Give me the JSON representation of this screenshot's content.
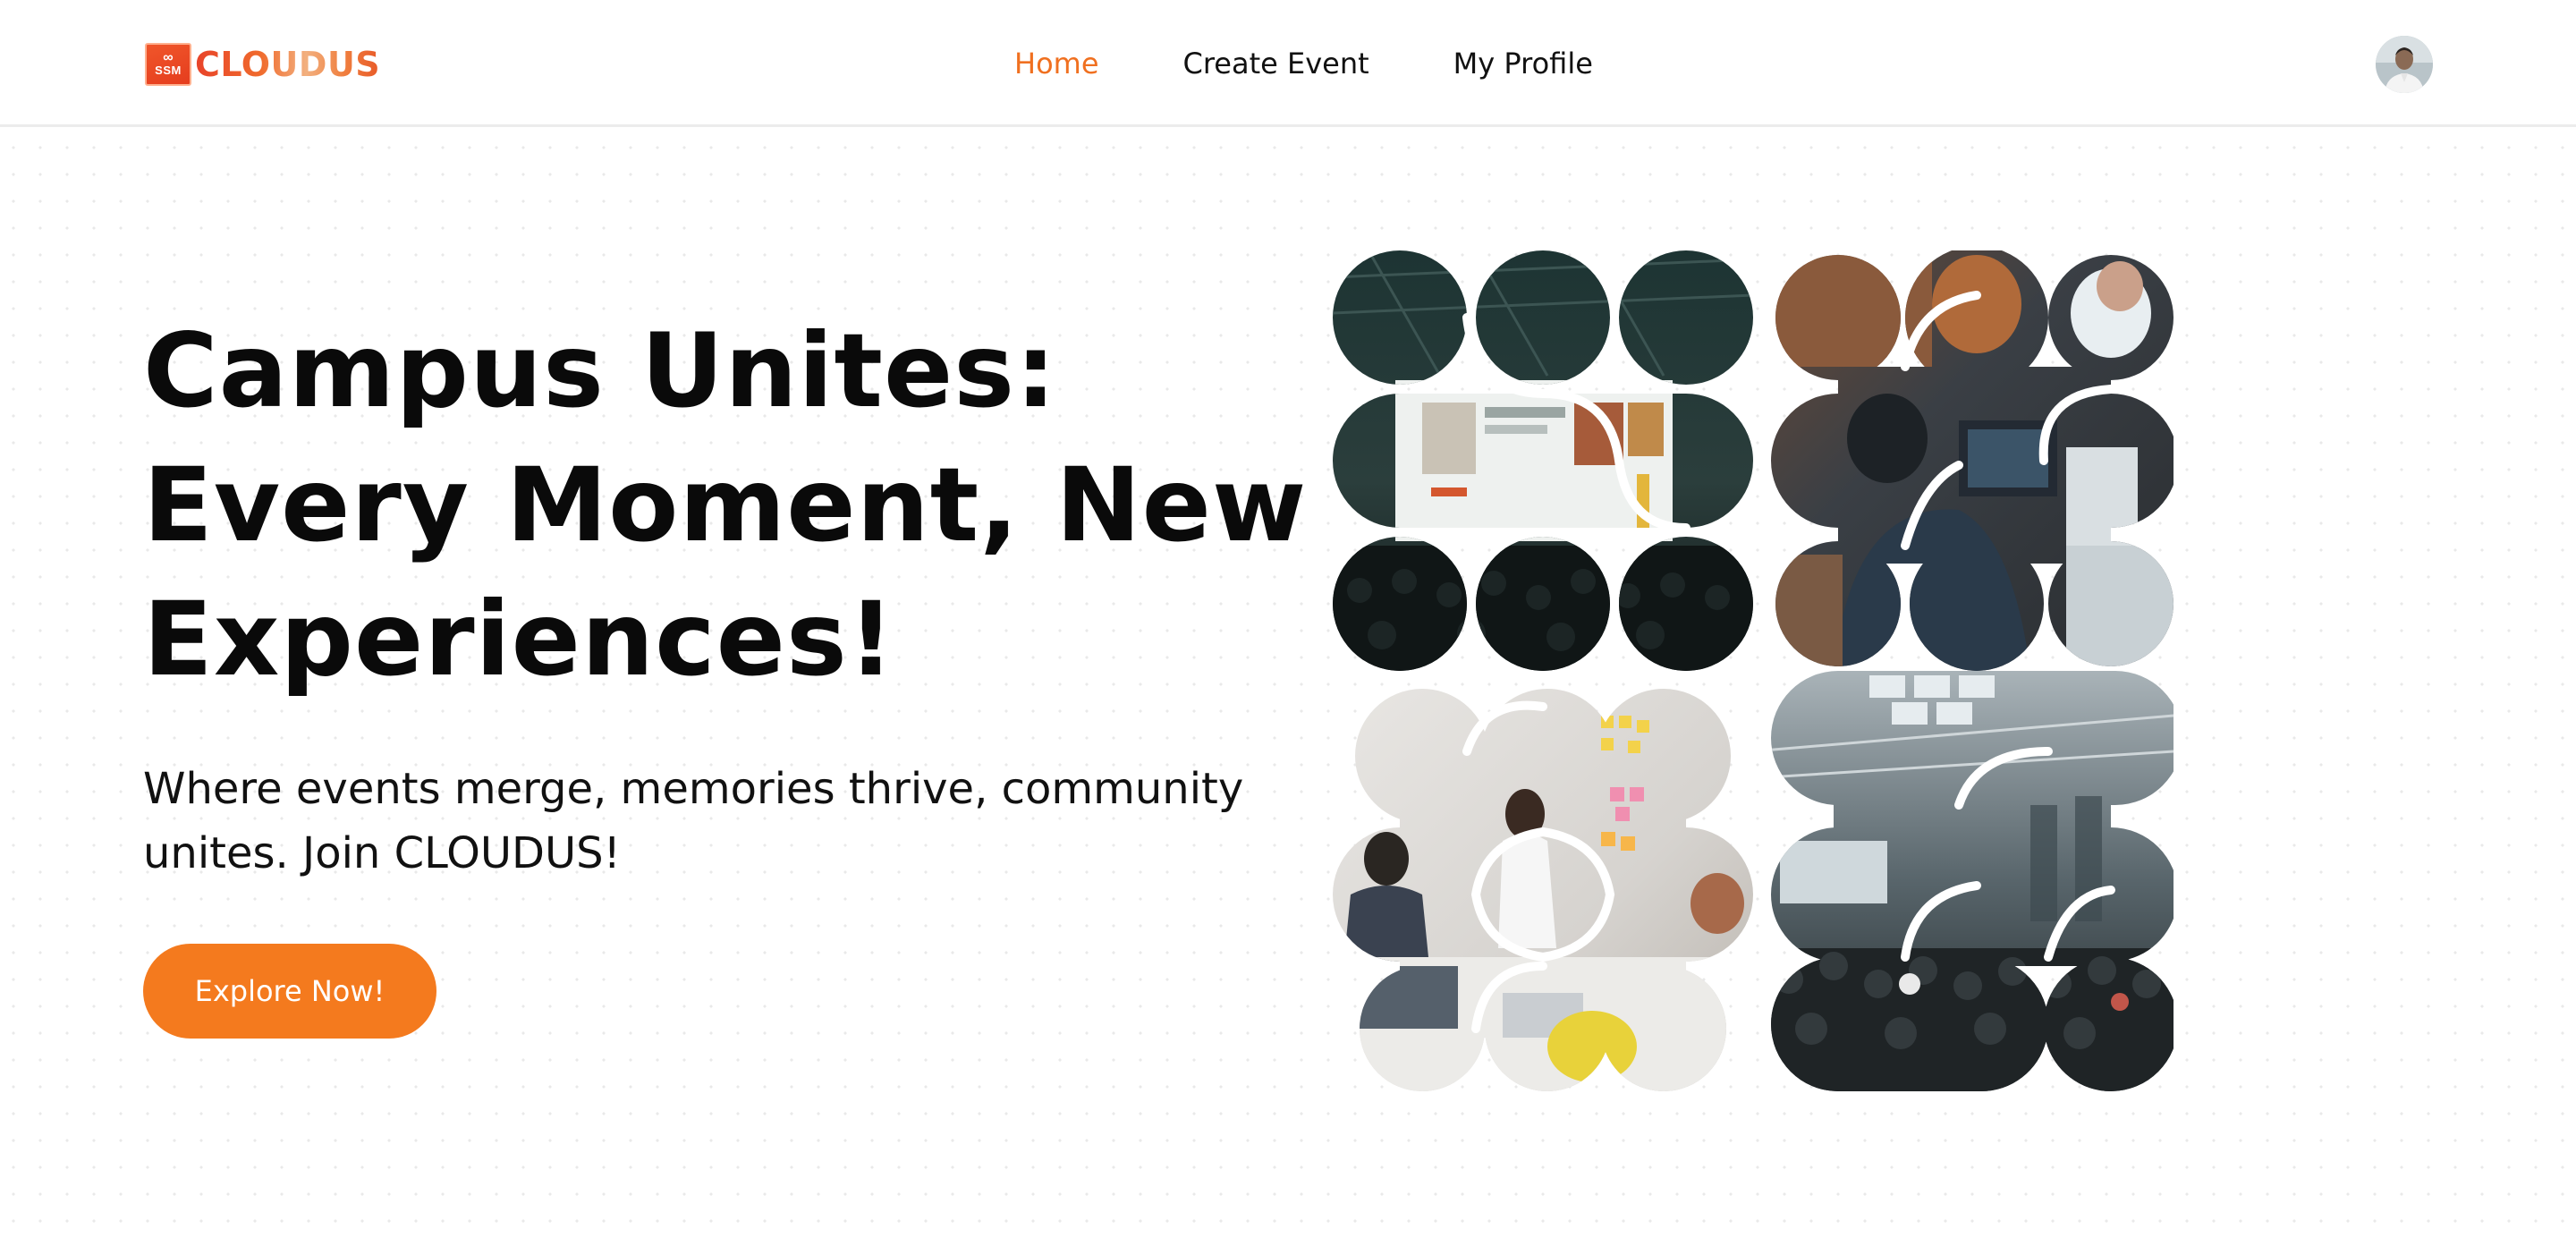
{
  "brand": {
    "badge_symbol": "∞",
    "badge_text": "SSM",
    "name": "CLOUDUS"
  },
  "nav": {
    "links": [
      {
        "label": "Home",
        "active": true
      },
      {
        "label": "Create Event",
        "active": false
      },
      {
        "label": "My Profile",
        "active": false
      }
    ]
  },
  "hero": {
    "title_lines": [
      "Campus Unites:",
      "Every Moment, New",
      "Experiences!"
    ],
    "subtitle_lines": [
      "Where events merge, memories thrive, community",
      "unites. Join CLOUDUS!"
    ],
    "cta_label": "Explore Now!"
  },
  "colors": {
    "accent": "#f47a1e",
    "nav_active": "#f07020",
    "brand_red": "#e8432a",
    "text": "#0a0a0a"
  },
  "icons": {
    "avatar": "user-avatar-photo",
    "logo": "ssm-infinity-logo"
  }
}
